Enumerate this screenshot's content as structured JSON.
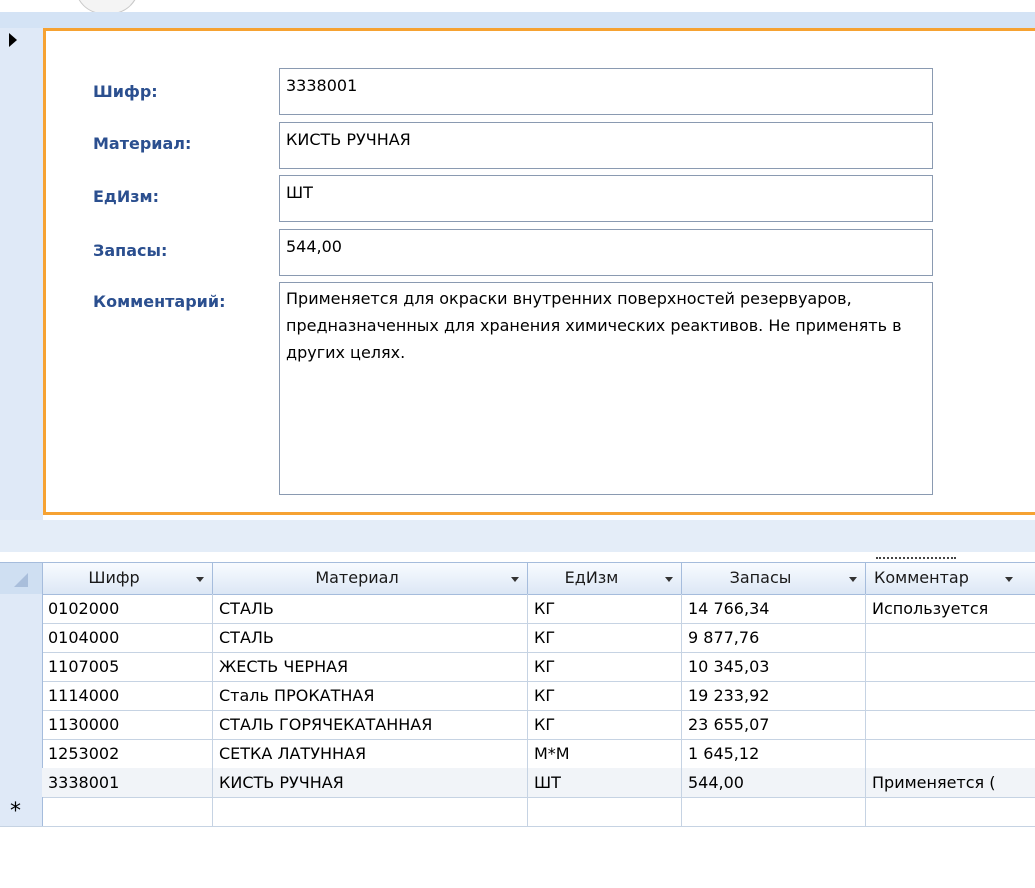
{
  "form": {
    "fields": [
      {
        "label": "Шифр:",
        "value": "3338001"
      },
      {
        "label": "Материал:",
        "value": "КИСТЬ РУЧНАЯ"
      },
      {
        "label": "ЕдИзм:",
        "value": "ШТ"
      },
      {
        "label": "Запасы:",
        "value": "544,00"
      }
    ],
    "comment": {
      "label": "Комментарий:",
      "value": "Применяется для окраски внутренних поверхностей резервуаров, предназначенных для хранения химических реактивов. Не применять в других целях."
    }
  },
  "datasheet": {
    "columns": [
      "Шифр",
      "Материал",
      "ЕдИзм",
      "Запасы",
      "Комментар"
    ],
    "rows": [
      [
        "0102000",
        "СТАЛЬ",
        "КГ",
        "14 766,34",
        "Используется"
      ],
      [
        "0104000",
        "СТАЛЬ",
        "КГ",
        "9 877,76",
        ""
      ],
      [
        "1107005",
        "ЖЕСТЬ ЧЕРНАЯ",
        "КГ",
        "10 345,03",
        ""
      ],
      [
        "1114000",
        "Сталь ПРОКАТНАЯ",
        "КГ",
        "19 233,92",
        ""
      ],
      [
        "1130000",
        "СТАЛЬ ГОРЯЧЕКАТАННАЯ",
        "КГ",
        "23 655,07",
        ""
      ],
      [
        "1253002",
        "СЕТКА ЛАТУННАЯ",
        "М*М",
        "1 645,12",
        ""
      ],
      [
        "3338001",
        "КИСТЬ РУЧНАЯ",
        "ШТ",
        "544,00",
        "Применяется ("
      ]
    ],
    "new_row_marker": "*"
  },
  "colors": {
    "accent_border": "#f6a232",
    "label_text": "#2b4f8f",
    "header_bg": "#dce7f5"
  }
}
